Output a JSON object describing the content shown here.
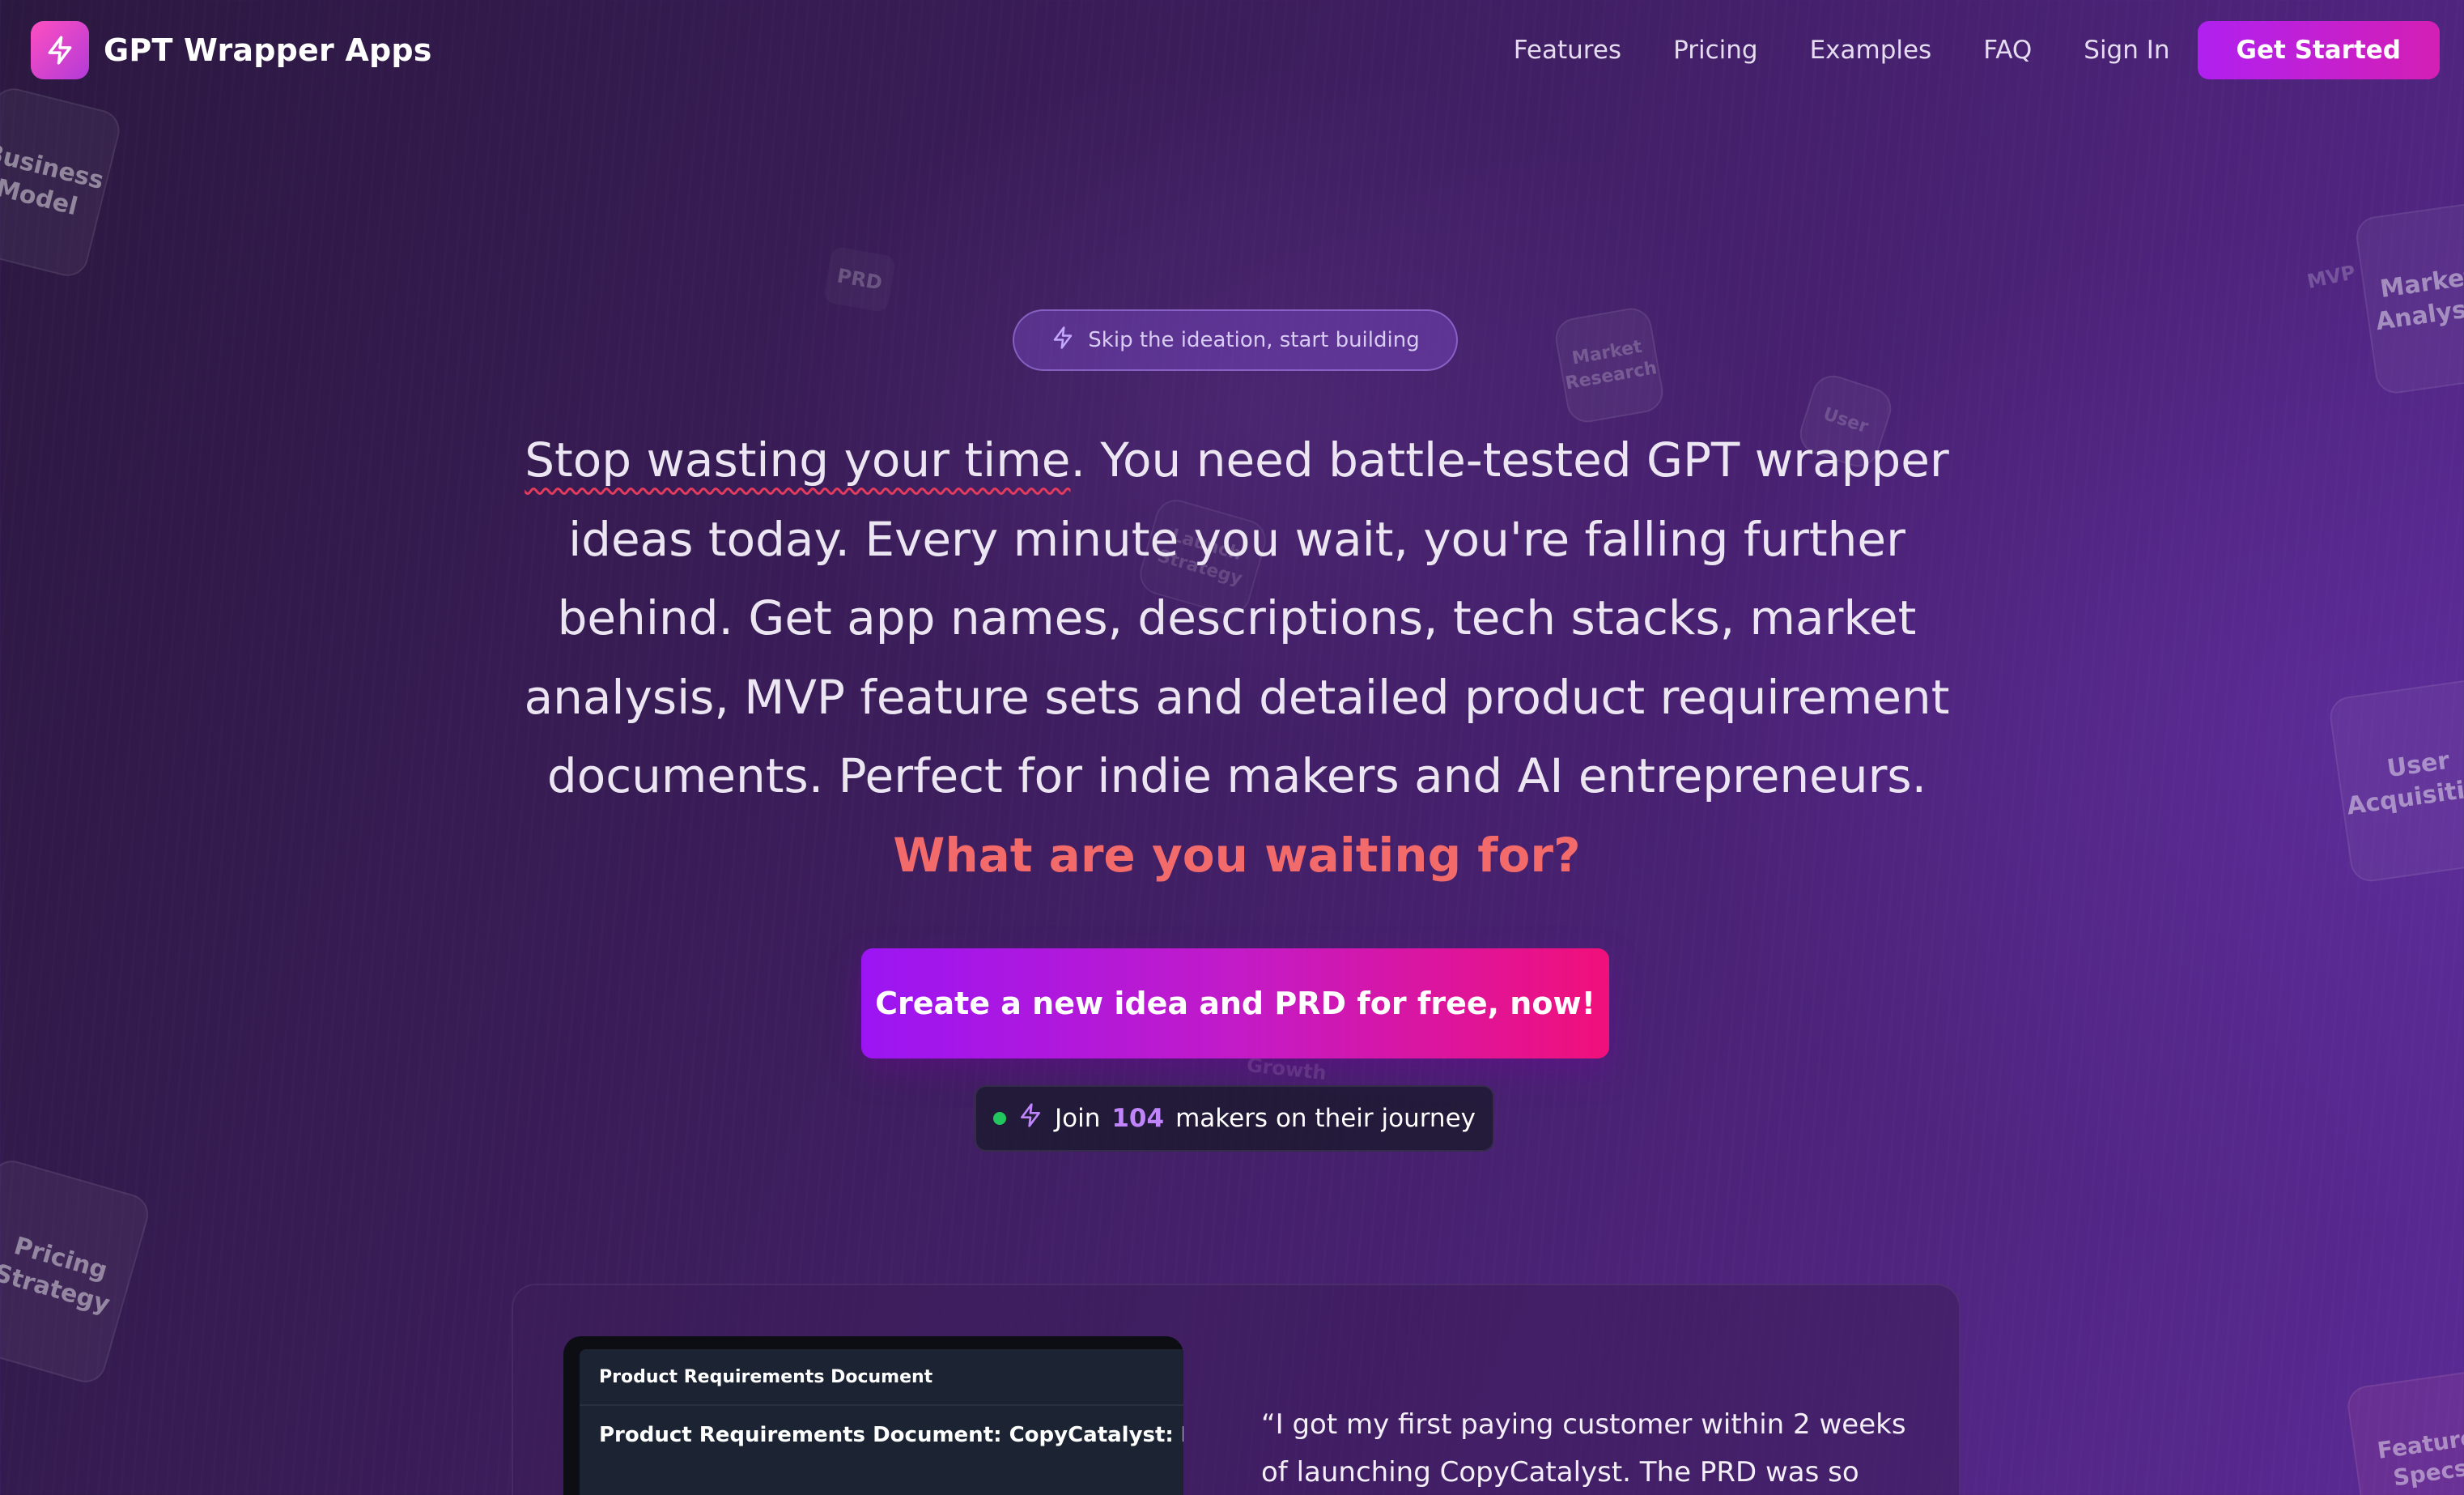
{
  "header": {
    "brand_name": "GPT Wrapper Apps",
    "logo_icon": "lightning-bolt-icon",
    "nav": [
      "Features",
      "Pricing",
      "Examples",
      "FAQ",
      "Sign In"
    ],
    "cta_label": "Get Started"
  },
  "hero": {
    "pill_text": "Skip the ideation, start building",
    "headline": {
      "underlined": "Stop wasting your time",
      "body": ". You need battle-tested GPT wrapper ideas today. Every minute you wait, you're falling further behind. Get app names, descriptions, tech stacks, market analysis, MVP feature sets and detailed product requirement documents. Perfect for indie makers and AI entrepreneurs. ",
      "accent": "What are you waiting for?"
    },
    "cta_label": "Create a new idea and PRD for free, now!",
    "join": {
      "prefix": "Join",
      "count": "104",
      "suffix": "makers on their journey"
    }
  },
  "floating_cards": [
    {
      "label": "Business Model"
    },
    {
      "label": "PRD"
    },
    {
      "label": "Market Research"
    },
    {
      "label": "User"
    },
    {
      "label": "Launch Strategy"
    },
    {
      "label": "MVP"
    },
    {
      "label": "Market Analysis"
    },
    {
      "label": "User Acquisition"
    },
    {
      "label": "Pricing Strategy"
    },
    {
      "label": "Growth"
    },
    {
      "label": "Feature Specs"
    }
  ],
  "showcase": {
    "window_title": "Product Requirements Document",
    "doc_title": "Product Requirements Document: CopyCatalyst: Dynamic Content Generator",
    "quote": "“I got my first paying customer within 2 weeks of launching CopyCatalyst. The PRD was so"
  },
  "colors": {
    "accent_pink": "#f26a6a",
    "cta_gradient_start": "#9b15f3",
    "cta_gradient_end": "#f1107a",
    "online_dot": "#22c55e",
    "count_purple": "#c084fc"
  }
}
